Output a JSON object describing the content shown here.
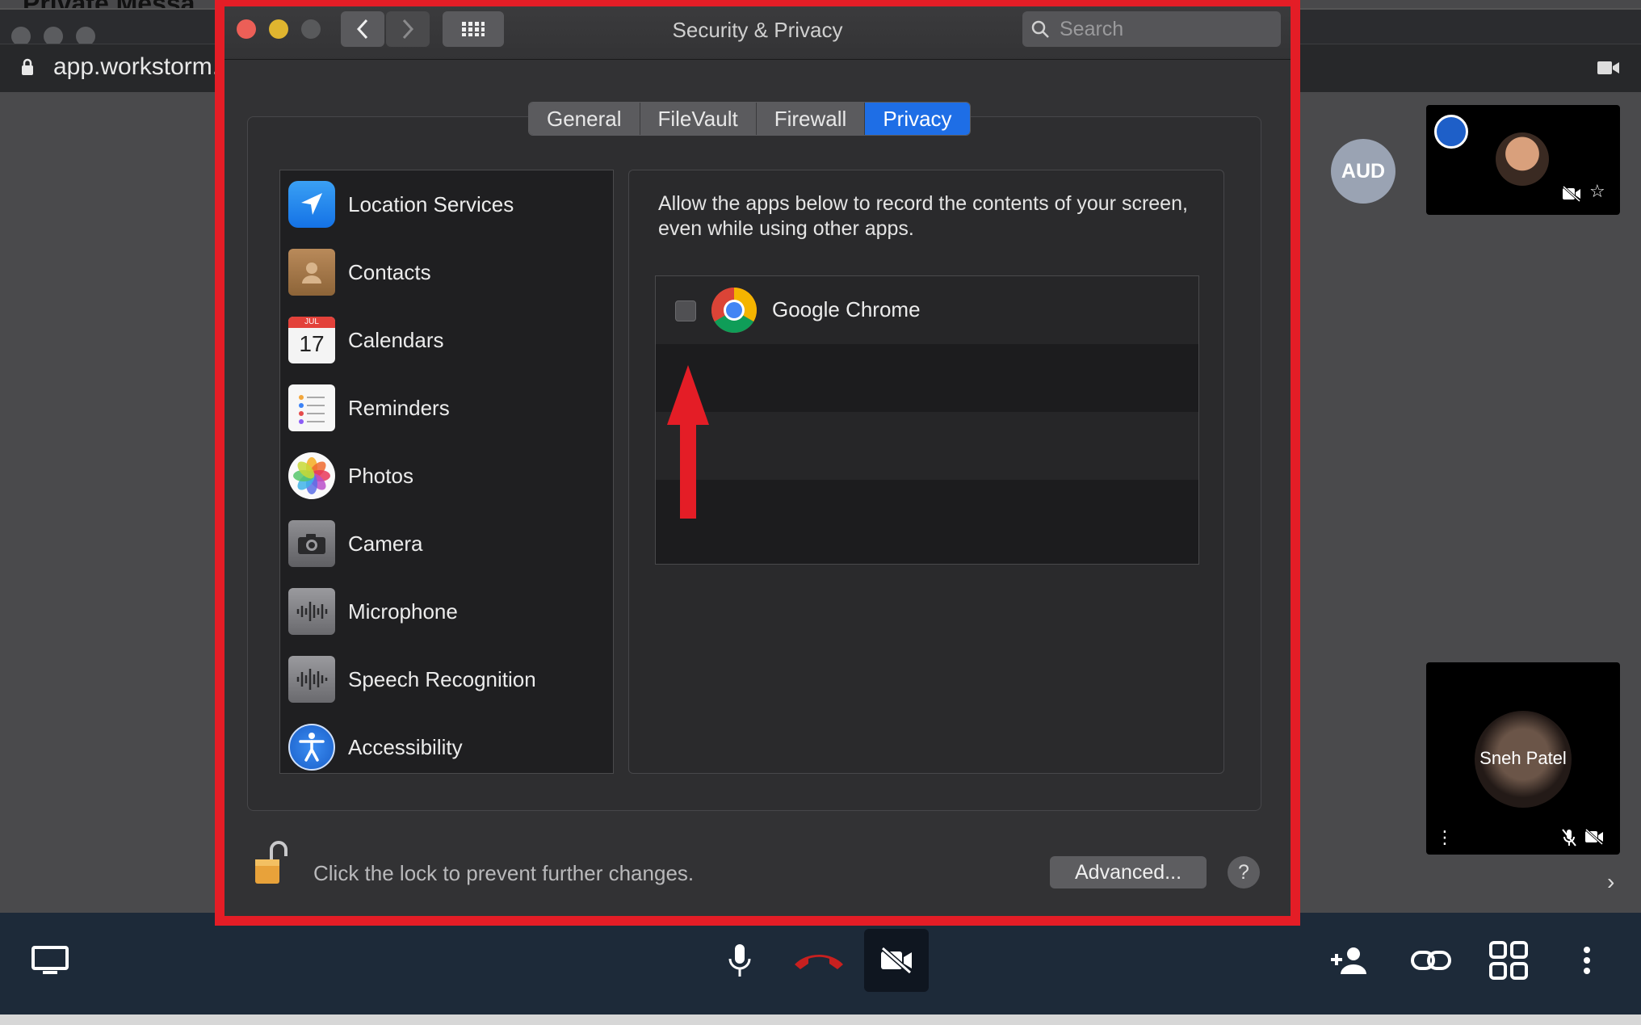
{
  "background_app": {
    "title_peek": "Private Messa",
    "url": "app.workstorm.c",
    "participant_avatar": "AUD",
    "tile_2_name": "Sneh Patel"
  },
  "window": {
    "title": "Security & Privacy",
    "search": {
      "placeholder": "Search",
      "value": ""
    }
  },
  "tabs": [
    {
      "label": "General",
      "active": false
    },
    {
      "label": "FileVault",
      "active": false
    },
    {
      "label": "Firewall",
      "active": false
    },
    {
      "label": "Privacy",
      "active": true
    }
  ],
  "categories": [
    {
      "label": "Location Services",
      "icon": "location-arrow-icon"
    },
    {
      "label": "Contacts",
      "icon": "contacts-book-icon"
    },
    {
      "label": "Calendars",
      "icon": "calendar-icon",
      "month": "JUL",
      "day": "17"
    },
    {
      "label": "Reminders",
      "icon": "reminders-list-icon"
    },
    {
      "label": "Photos",
      "icon": "photos-flower-icon"
    },
    {
      "label": "Camera",
      "icon": "camera-icon"
    },
    {
      "label": "Microphone",
      "icon": "microphone-waveform-icon"
    },
    {
      "label": "Speech Recognition",
      "icon": "speech-waveform-icon"
    },
    {
      "label": "Accessibility",
      "icon": "accessibility-icon"
    }
  ],
  "detail": {
    "description": "Allow the apps below to record the contents of your screen, even while using other apps.",
    "apps": [
      {
        "name": "Google Chrome",
        "checked": false,
        "icon": "chrome-icon"
      }
    ]
  },
  "footer": {
    "lock_label": "Click the lock to prevent further changes.",
    "advanced_label": "Advanced...",
    "help_label": "?"
  },
  "colors": {
    "highlight": "#e41d26",
    "accent": "#1e6ee6",
    "arrow": "#e41d26",
    "call_bar": "#1d2a39",
    "end_call": "#c8201f"
  }
}
